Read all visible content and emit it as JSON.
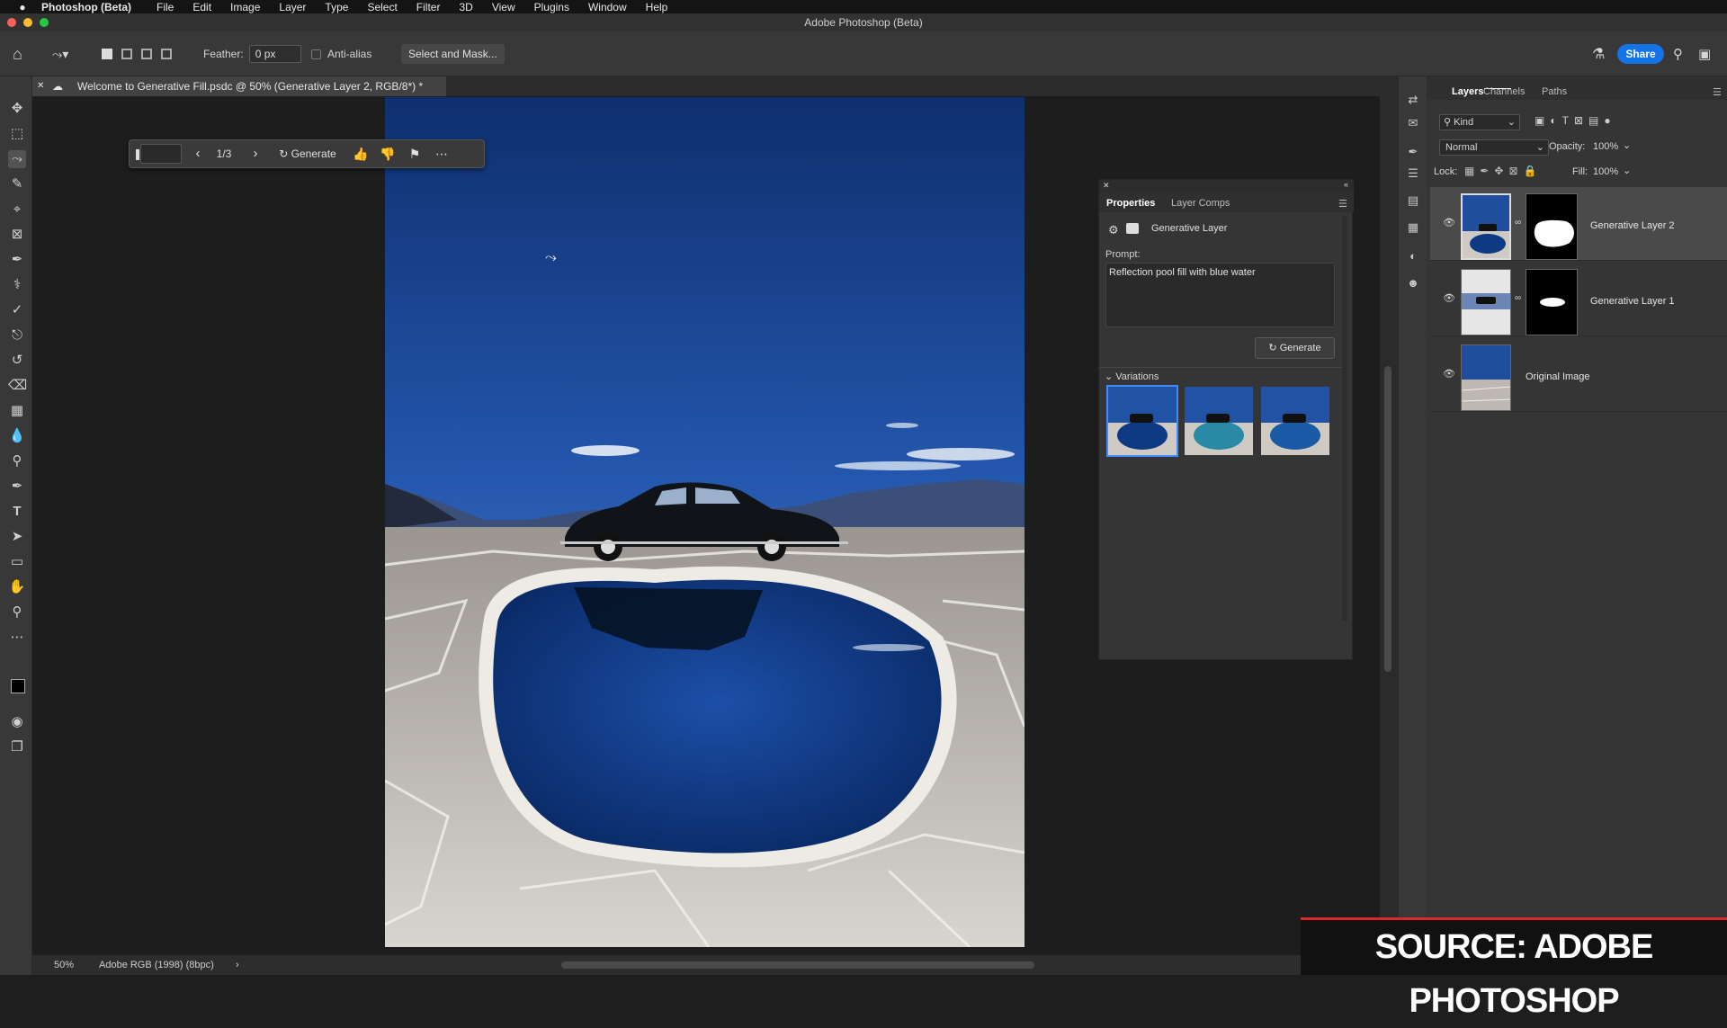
{
  "menubar": {
    "app_name": "Photoshop (Beta)",
    "items": [
      "File",
      "Edit",
      "Image",
      "Layer",
      "Type",
      "Select",
      "Filter",
      "3D",
      "View",
      "Plugins",
      "Window",
      "Help"
    ]
  },
  "window": {
    "title": "Adobe Photoshop (Beta)"
  },
  "options_bar": {
    "feather_label": "Feather:",
    "feather_value": "0 px",
    "antialias_label": "Anti-alias",
    "select_mask_label": "Select and Mask...",
    "share_label": "Share"
  },
  "document": {
    "tab_title": "Welcome to Generative Fill.psdc @ 50% (Generative Layer 2, RGB/8*) *"
  },
  "gen_toolbar": {
    "counter": "1/3",
    "generate_label": "Generate"
  },
  "properties": {
    "tabs": [
      "Properties",
      "Layer Comps"
    ],
    "layer_type": "Generative Layer",
    "prompt_label": "Prompt:",
    "prompt_value": "Reflection pool fill with blue water",
    "generate_label": "Generate",
    "variations_label": "Variations",
    "selected_variation": 1
  },
  "layers_panel": {
    "tabs": [
      "Layers",
      "Channels",
      "Paths"
    ],
    "filter_kind": "Kind",
    "blend_mode": "Normal",
    "opacity_label": "Opacity:",
    "opacity_value": "100%",
    "lock_label": "Lock:",
    "fill_label": "Fill:",
    "fill_value": "100%",
    "layers": [
      {
        "name": "Generative Layer 2",
        "selected": true
      },
      {
        "name": "Generative Layer 1",
        "selected": false
      },
      {
        "name": "Original Image",
        "selected": false
      }
    ]
  },
  "status_bar": {
    "zoom": "50%",
    "color_profile": "Adobe RGB (1998) (8bpc)"
  },
  "caption": {
    "text": "SOURCE: ADOBE PHOTOSHOP"
  },
  "colors": {
    "accent": "#1473e6",
    "panel": "#353535",
    "canvas": "#1d1d1d"
  }
}
